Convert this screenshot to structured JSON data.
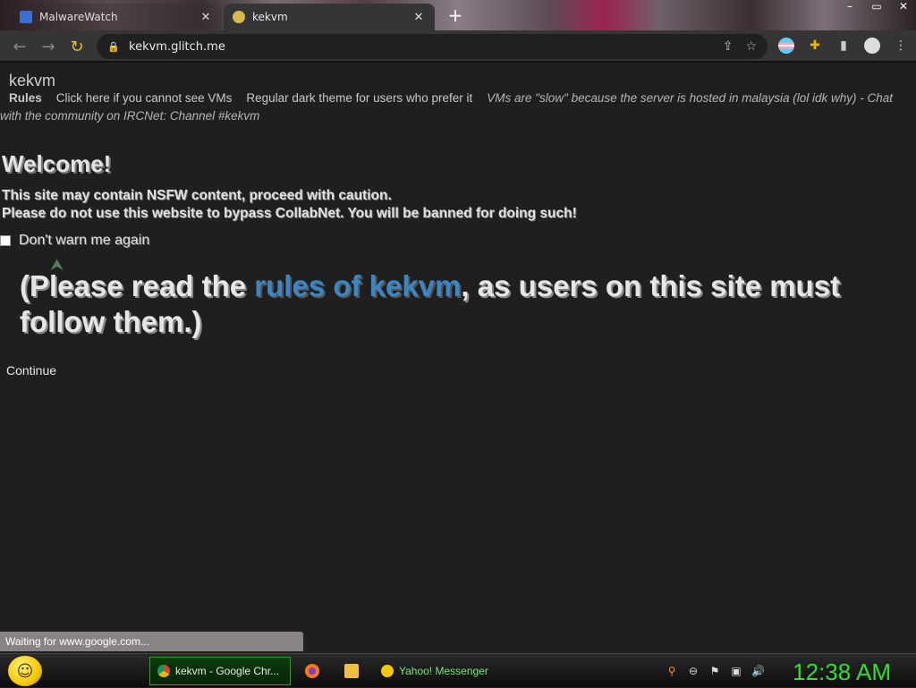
{
  "browser": {
    "tabs": [
      {
        "label": "MalwareWatch",
        "active": false
      },
      {
        "label": "kekvm",
        "active": true
      }
    ],
    "new_tab_glyph": "+",
    "url": "kekvm.glitch.me",
    "window_controls": [
      "–",
      "▭",
      "✕"
    ]
  },
  "page": {
    "site_title": "kekvm",
    "nav": {
      "rules": "Rules",
      "link_vms": "Click here if you cannot see VMs",
      "link_theme": "Regular dark theme for users who prefer it",
      "note": "VMs are \"slow\" because the server is hosted in malaysia (lol idk why) - Chat with the community on IRCNet: Channel #kekvm"
    },
    "welcome_title": "Welcome!",
    "warning_1": "This site may contain NSFW content, proceed with caution.",
    "warning_2": "Please do not use this website to bypass CollabNet. You will be banned for doing such!",
    "dont_warn_label": "Don't warn me again",
    "rules_notice": {
      "before": "(Please read the ",
      "link": "rules of kekvm",
      "after": ", as users on this site must follow them.)"
    },
    "continue_label": "Continue",
    "status_text": "Waiting for www.google.com..."
  },
  "taskbar": {
    "items": [
      {
        "label": "kekvm - Google Chr...",
        "active": true
      },
      {
        "label": "Yahoo! Messenger",
        "active": false
      }
    ],
    "clock": "12:38 AM"
  },
  "colors": {
    "page_bg": "#1f1f1f",
    "link": "#3d86c6",
    "clock": "#2ee02e",
    "taskbar_active_border": "#1faa1f"
  }
}
